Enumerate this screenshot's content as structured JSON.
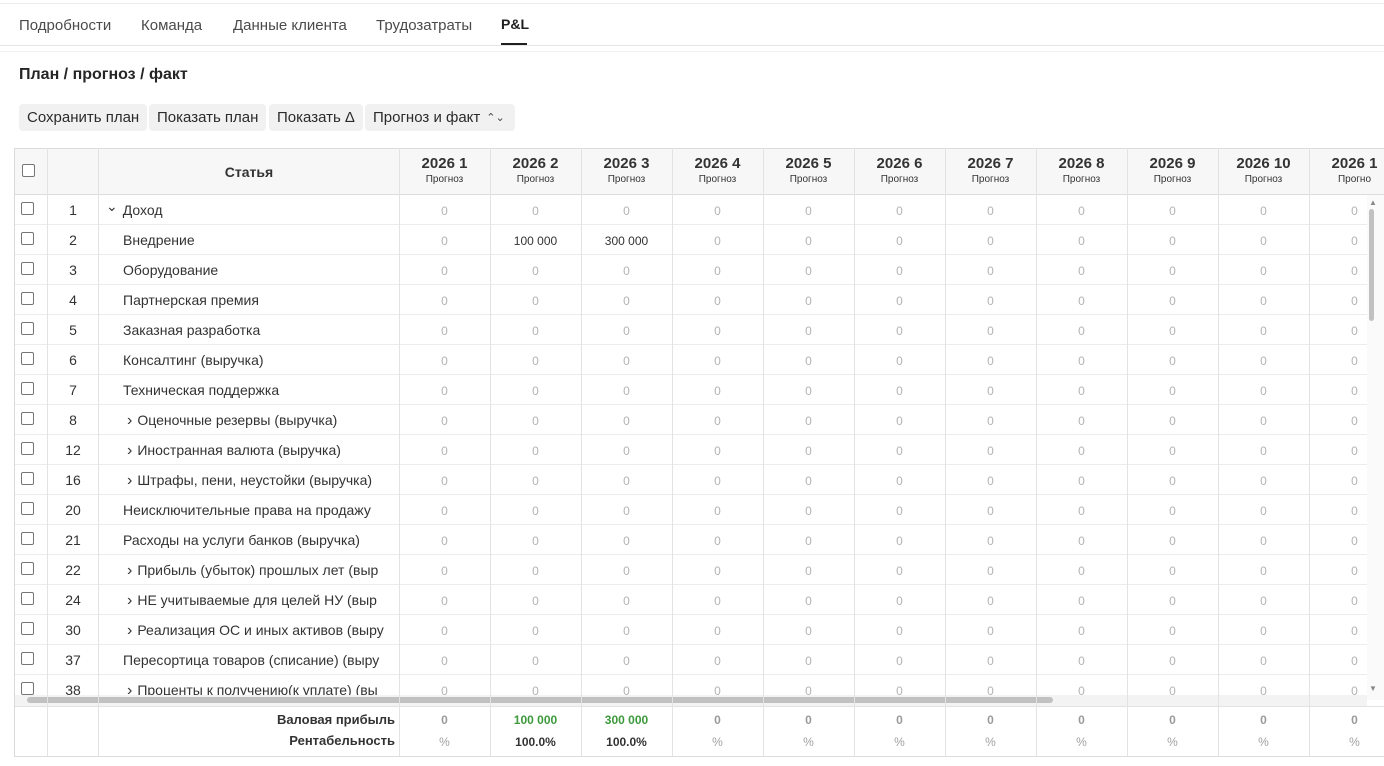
{
  "tabs": [
    "Подробности",
    "Команда",
    "Данные клиента",
    "Трудозатраты",
    "P&L"
  ],
  "active_tab": "P&L",
  "section_title": "План / прогноз / факт",
  "toolbar": {
    "save_plan": "Сохранить план",
    "show_plan": "Показать план",
    "show_delta": "Показать Δ",
    "mode_select": "Прогноз и факт"
  },
  "table": {
    "article_header": "Статья",
    "months": [
      {
        "label": "2026 1",
        "sub": "Прогноз"
      },
      {
        "label": "2026 2",
        "sub": "Прогноз"
      },
      {
        "label": "2026 3",
        "sub": "Прогноз"
      },
      {
        "label": "2026 4",
        "sub": "Прогноз"
      },
      {
        "label": "2026 5",
        "sub": "Прогноз"
      },
      {
        "label": "2026 6",
        "sub": "Прогноз"
      },
      {
        "label": "2026 7",
        "sub": "Прогноз"
      },
      {
        "label": "2026 8",
        "sub": "Прогноз"
      },
      {
        "label": "2026 9",
        "sub": "Прогноз"
      },
      {
        "label": "2026 10",
        "sub": "Прогноз"
      },
      {
        "label": "2026 1",
        "sub": "Прогно"
      }
    ],
    "rows": [
      {
        "num": "1",
        "name": "Доход",
        "caret": "down",
        "level": 0,
        "values": [
          "0",
          "0",
          "0",
          "0",
          "0",
          "0",
          "0",
          "0",
          "0",
          "0",
          "0"
        ]
      },
      {
        "num": "2",
        "name": "Внедрение",
        "caret": "",
        "level": 1,
        "values": [
          "0",
          "100 000",
          "300 000",
          "0",
          "0",
          "0",
          "0",
          "0",
          "0",
          "0",
          "0"
        ]
      },
      {
        "num": "3",
        "name": "Оборудование",
        "caret": "",
        "level": 1,
        "values": [
          "0",
          "0",
          "0",
          "0",
          "0",
          "0",
          "0",
          "0",
          "0",
          "0",
          "0"
        ]
      },
      {
        "num": "4",
        "name": "Партнерская премия",
        "caret": "",
        "level": 1,
        "values": [
          "0",
          "0",
          "0",
          "0",
          "0",
          "0",
          "0",
          "0",
          "0",
          "0",
          "0"
        ]
      },
      {
        "num": "5",
        "name": "Заказная разработка",
        "caret": "",
        "level": 1,
        "values": [
          "0",
          "0",
          "0",
          "0",
          "0",
          "0",
          "0",
          "0",
          "0",
          "0",
          "0"
        ]
      },
      {
        "num": "6",
        "name": "Консалтинг (выручка)",
        "caret": "",
        "level": 1,
        "values": [
          "0",
          "0",
          "0",
          "0",
          "0",
          "0",
          "0",
          "0",
          "0",
          "0",
          "0"
        ]
      },
      {
        "num": "7",
        "name": "Техническая поддержка",
        "caret": "",
        "level": 1,
        "values": [
          "0",
          "0",
          "0",
          "0",
          "0",
          "0",
          "0",
          "0",
          "0",
          "0",
          "0"
        ]
      },
      {
        "num": "8",
        "name": "Оценочные резервы (выручка)",
        "caret": "right",
        "level": 2,
        "values": [
          "0",
          "0",
          "0",
          "0",
          "0",
          "0",
          "0",
          "0",
          "0",
          "0",
          "0"
        ]
      },
      {
        "num": "12",
        "name": "Иностранная валюта (выручка)",
        "caret": "right",
        "level": 2,
        "values": [
          "0",
          "0",
          "0",
          "0",
          "0",
          "0",
          "0",
          "0",
          "0",
          "0",
          "0"
        ]
      },
      {
        "num": "16",
        "name": "Штрафы, пени, неустойки (выручка)",
        "caret": "right",
        "level": 2,
        "values": [
          "0",
          "0",
          "0",
          "0",
          "0",
          "0",
          "0",
          "0",
          "0",
          "0",
          "0"
        ]
      },
      {
        "num": "20",
        "name": "Неисключительные права на продажу",
        "caret": "",
        "level": 1,
        "values": [
          "0",
          "0",
          "0",
          "0",
          "0",
          "0",
          "0",
          "0",
          "0",
          "0",
          "0"
        ]
      },
      {
        "num": "21",
        "name": "Расходы на услуги банков (выручка)",
        "caret": "",
        "level": 1,
        "values": [
          "0",
          "0",
          "0",
          "0",
          "0",
          "0",
          "0",
          "0",
          "0",
          "0",
          "0"
        ]
      },
      {
        "num": "22",
        "name": "Прибыль (убыток) прошлых лет (выр",
        "caret": "right",
        "level": 2,
        "values": [
          "0",
          "0",
          "0",
          "0",
          "0",
          "0",
          "0",
          "0",
          "0",
          "0",
          "0"
        ]
      },
      {
        "num": "24",
        "name": "НЕ учитываемые  для целей НУ (выр",
        "caret": "right",
        "level": 2,
        "values": [
          "0",
          "0",
          "0",
          "0",
          "0",
          "0",
          "0",
          "0",
          "0",
          "0",
          "0"
        ]
      },
      {
        "num": "30",
        "name": "Реализация ОС и иных активов (выру",
        "caret": "right",
        "level": 2,
        "values": [
          "0",
          "0",
          "0",
          "0",
          "0",
          "0",
          "0",
          "0",
          "0",
          "0",
          "0"
        ]
      },
      {
        "num": "37",
        "name": "Пересортица товаров (списание) (выру",
        "caret": "",
        "level": 1,
        "values": [
          "0",
          "0",
          "0",
          "0",
          "0",
          "0",
          "0",
          "0",
          "0",
          "0",
          "0"
        ]
      },
      {
        "num": "38",
        "name": "Проценты к получению(к уплате) (вы",
        "caret": "right",
        "level": 2,
        "values": [
          "0",
          "0",
          "0",
          "0",
          "0",
          "0",
          "0",
          "0",
          "0",
          "0",
          "0"
        ]
      }
    ],
    "footer": {
      "gross_label": "Валовая прибыль",
      "gross_values": [
        "0",
        "100 000",
        "300 000",
        "0",
        "0",
        "0",
        "0",
        "0",
        "0",
        "0",
        "0"
      ],
      "margin_label": "Рентабельность",
      "margin_values": [
        "%",
        "100.0%",
        "100.0%",
        "%",
        "%",
        "%",
        "%",
        "%",
        "%",
        "%",
        "%"
      ]
    }
  },
  "colors": {
    "positive": "#3c9a3c",
    "zero": "#b3b3b3",
    "header_bg": "#f7f7f7"
  },
  "icons": {
    "expanded": "chevron-down-icon",
    "collapsed": "chevron-right-icon",
    "select": "chevron-up-down-icon"
  }
}
